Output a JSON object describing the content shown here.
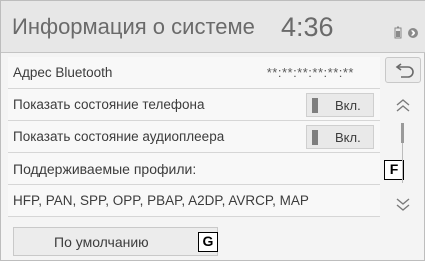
{
  "header": {
    "title": "Информация о системе",
    "clock": "4:36"
  },
  "rows": {
    "bluetooth_address": {
      "label": "Адрес Bluetooth",
      "value": "**:**:**:**:**:**"
    },
    "phone_status": {
      "label": "Показать состояние телефона",
      "toggle": "Вкл."
    },
    "audio_status": {
      "label": "Показать состояние аудиоплеера",
      "toggle": "Вкл."
    },
    "profiles_heading": {
      "label": "Поддерживаемые профили:"
    },
    "profiles_list": {
      "label": "HFP, PAN, SPP, OPP, PBAP, A2DP, AVRCP, MAP"
    }
  },
  "buttons": {
    "default_label": "По умолчанию"
  },
  "callouts": {
    "f": "F",
    "g": "G"
  },
  "icons": {
    "back": "back-arrow-icon",
    "scroll_up": "chevron-double-up-icon",
    "scroll_down": "chevron-double-down-icon",
    "battery": "battery-icon",
    "bluetooth": "bluetooth-icon"
  },
  "scrollbar": {
    "position_fraction": 0
  }
}
